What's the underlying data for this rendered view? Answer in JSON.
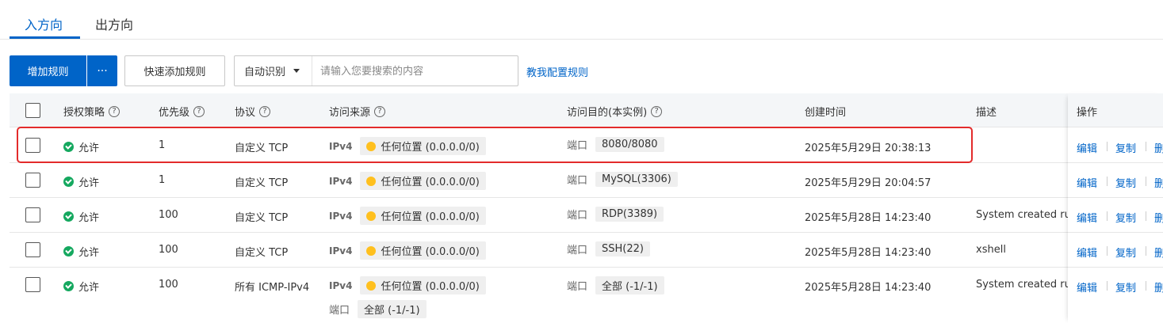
{
  "tabs": [
    {
      "label": "入方向",
      "active": true
    },
    {
      "label": "出方向",
      "active": false
    }
  ],
  "toolbar": {
    "add_rule": "增加规则",
    "more": "···",
    "quick_add": "快速添加规则",
    "search_type": "自动识别",
    "search_placeholder": "请输入您要搜索的内容",
    "help_link": "教我配置规则"
  },
  "table": {
    "headers": {
      "policy": "授权策略",
      "priority": "优先级",
      "protocol": "协议",
      "source": "访问来源",
      "dest": "访问目的(本实例)",
      "created": "创建时间",
      "desc": "描述",
      "actions": "操作"
    },
    "rows": [
      {
        "policy": "允许",
        "priority": "1",
        "protocol": "自定义 TCP",
        "ip_ver": "IPv4",
        "source": "任何位置 (0.0.0.0/0)",
        "port_label": "端口",
        "port": "8080/8080",
        "created": "2025年5月29日 20:38:13",
        "desc": ""
      },
      {
        "policy": "允许",
        "priority": "1",
        "protocol": "自定义 TCP",
        "ip_ver": "IPv4",
        "source": "任何位置 (0.0.0.0/0)",
        "port_label": "端口",
        "port": "MySQL(3306)",
        "created": "2025年5月29日 20:04:57",
        "desc": ""
      },
      {
        "policy": "允许",
        "priority": "100",
        "protocol": "自定义 TCP",
        "ip_ver": "IPv4",
        "source": "任何位置 (0.0.0.0/0)",
        "port_label": "端口",
        "port": "RDP(3389)",
        "created": "2025年5月28日 14:23:40",
        "desc": "System created rul"
      },
      {
        "policy": "允许",
        "priority": "100",
        "protocol": "自定义 TCP",
        "ip_ver": "IPv4",
        "source": "任何位置 (0.0.0.0/0)",
        "port_label": "端口",
        "port": "SSH(22)",
        "created": "2025年5月28日 14:23:40",
        "desc": "xshell"
      },
      {
        "policy": "允许",
        "priority": "100",
        "protocol": "所有 ICMP-IPv4",
        "ip_ver": "IPv4",
        "source": "任何位置 (0.0.0.0/0)",
        "port_label": "端口",
        "port": "全部 (-1/-1)",
        "created": "2025年5月28日 14:23:40",
        "desc": "System created rul",
        "source_port_label": "端口",
        "source_port": "全部 (-1/-1)"
      }
    ],
    "actions": {
      "edit": "编辑",
      "copy": "复制",
      "delete": "删"
    }
  },
  "colors": {
    "primary": "#0064c8",
    "allow": "#15a85f",
    "warn": "#ffc01e",
    "highlight": "#e32b2b"
  }
}
